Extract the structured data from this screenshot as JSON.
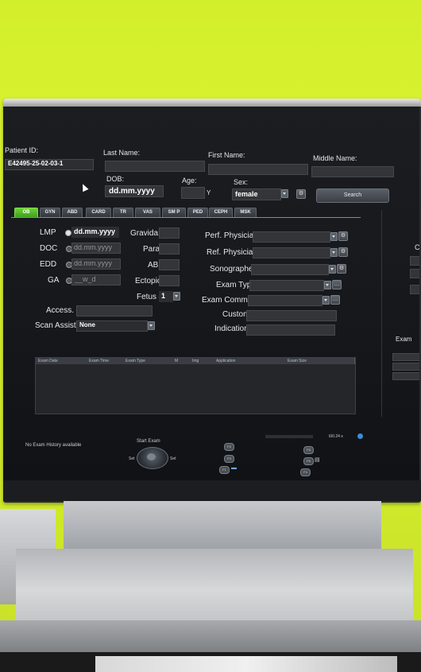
{
  "patient": {
    "patient_id_label": "Patient ID:",
    "patient_id_value": "E42495-25-02-03-1",
    "last_name_label": "Last Name:",
    "first_name_label": "First Name:",
    "middle_name_label": "Middle Name:",
    "dob_label": "DOB:",
    "dob_value": "dd.mm.yyyy",
    "age_label": "Age:",
    "age_unit": "Y",
    "sex_label": "Sex:",
    "sex_value": "female",
    "search_label": "Search"
  },
  "tabs": [
    {
      "label": "OB",
      "active": true
    },
    {
      "label": "GYN"
    },
    {
      "label": "ABD"
    },
    {
      "label": "CARD"
    },
    {
      "label": "TR"
    },
    {
      "label": "VAS"
    },
    {
      "label": "SM P"
    },
    {
      "label": "PED"
    },
    {
      "label": "CEPH"
    },
    {
      "label": "MSK"
    }
  ],
  "ob": {
    "lmp_label": "LMP",
    "lmp_value": "dd.mm.yyyy",
    "doc_label": "DOC",
    "doc_value": "dd.mm.yyyy",
    "edd_label": "EDD",
    "edd_value": "dd.mm.yyyy",
    "ga_label": "GA",
    "ga_value": "__w_d",
    "gravida_label": "Gravida:",
    "para_label": "Para:",
    "ab_label": "AB:",
    "ectopic_label": "Ectopic:",
    "fetus_label": "Fetus #:",
    "fetus_value": "1",
    "access_label": "Access. #:",
    "scan_assistant_label": "Scan Assistant:",
    "scan_assistant_value": "None"
  },
  "physicians": {
    "perf_label": "Perf. Physician:",
    "ref_label": "Ref. Physician:",
    "sonographer_label": "Sonographer:",
    "exam_type_label": "Exam Type:",
    "exam_comment_label": "Exam Comment:",
    "custom_label": "Custom:",
    "indication_label": "Indication:"
  },
  "exam_table": {
    "columns": [
      "Exam Date",
      "Exam Time",
      "Exam Type",
      "M",
      "Img",
      "Application",
      "Exam Size"
    ]
  },
  "right_panel": {
    "edge_letter": "C",
    "exam_label": "Exam"
  },
  "footer": {
    "no_history": "No Exam History available",
    "start_exam": "Start Exam",
    "set_left": "Set",
    "set_right": "Set",
    "storage": "6/0.24 s",
    "fkeys_left": [
      "F2",
      "F3",
      "F1"
    ],
    "fkeys_right": [
      "F5",
      "F6",
      "F4"
    ]
  },
  "colors": {
    "wall": "#d6ef2a",
    "screen": "#1b1d21",
    "active_tab": "#4fba25"
  }
}
